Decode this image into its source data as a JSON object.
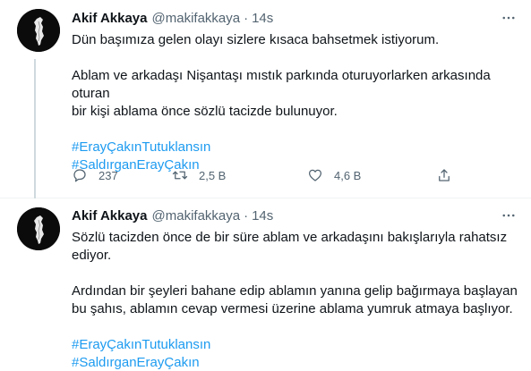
{
  "tweets": [
    {
      "name": "Akif Akkaya",
      "handle": "@makifakkaya",
      "separator": "·",
      "time": "14s",
      "lines": [
        "Dün başımıza gelen olayı sizlere kısaca bahsetmek istiyorum.",
        "",
        "Ablam ve arkadaşı Nişantaşı mıstık parkında oturuyorlarken arkasında oturan",
        "bir kişi ablama önce sözlü tacizde bulunuyor."
      ],
      "hashtags": [
        "#ErayÇakınTutuklansın",
        "#SaldırganErayÇakın"
      ],
      "reply_count": "237",
      "retweet_count": "2,5 B",
      "like_count": "4,6 B"
    },
    {
      "name": "Akif Akkaya",
      "handle": "@makifakkaya",
      "separator": "·",
      "time": "14s",
      "lines": [
        "Sözlü tacizden önce de bir süre ablam ve arkadaşını bakışlarıyla rahatsız",
        "ediyor.",
        "",
        "Ardından bir şeyleri bahane edip ablamın yanına gelip bağırmaya başlayan",
        "bu şahıs, ablamın cevap vermesi üzerine ablama yumruk atmaya başlıyor."
      ],
      "hashtags": [
        "#ErayÇakınTutuklansın",
        "#SaldırganErayÇakın"
      ]
    }
  ],
  "icons": {
    "more": "more-horizontal-icon",
    "reply": "reply-bubble-icon",
    "retweet": "retweet-icon",
    "like": "heart-icon",
    "share": "share-icon"
  },
  "colors": {
    "text": "#0f1419",
    "secondary": "#536471",
    "link": "#1d9bf0",
    "divider": "#eff3f4",
    "thread_line": "#cfd9de"
  }
}
